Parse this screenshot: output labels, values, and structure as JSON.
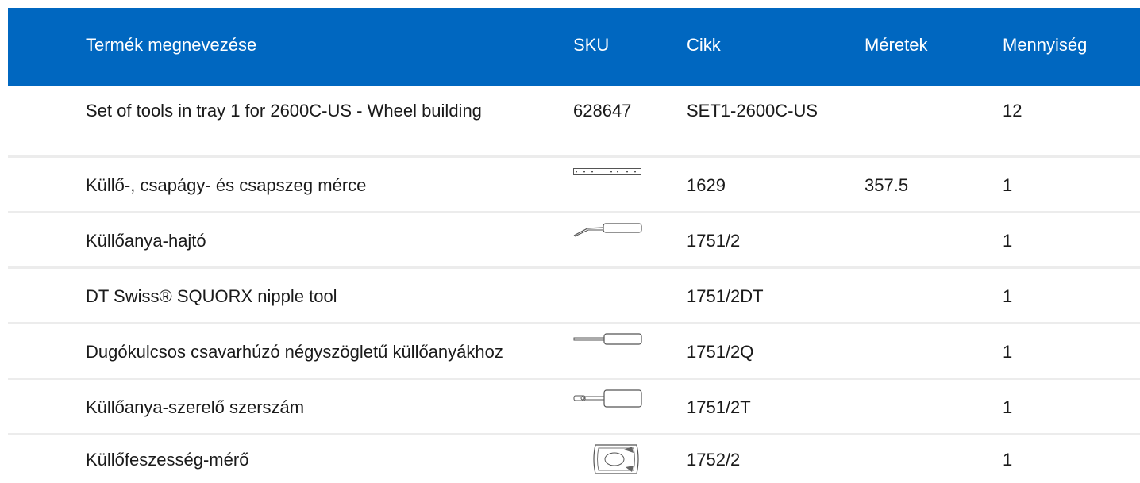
{
  "header": {
    "name": "Termék megnevezése",
    "sku": "SKU",
    "cikk": "Cikk",
    "size": "Méretek",
    "qty": "Mennyiség"
  },
  "rows": [
    {
      "name": "Set of tools in tray 1 for 2600C-US - Wheel building",
      "sku": "628647",
      "cikk": "SET1-2600C-US",
      "size": "",
      "qty": "12",
      "image": ""
    },
    {
      "name": "Küllő-, csapágy- és csapszeg mérce",
      "sku": "",
      "cikk": "1629",
      "size": "357.5",
      "qty": "1",
      "image": "ruler-icon"
    },
    {
      "name": "Küllőanya-hajtó",
      "sku": "",
      "cikk": "1751/2",
      "size": "",
      "qty": "1",
      "image": "nipple-driver-icon"
    },
    {
      "name": "DT Swiss® SQUORX nipple tool",
      "sku": "",
      "cikk": "1751/2DT",
      "size": "",
      "qty": "1",
      "image": ""
    },
    {
      "name": "Dugókulcsos csavarhúzó négyszögletű küllőanyákhoz",
      "sku": "",
      "cikk": "1751/2Q",
      "size": "",
      "qty": "1",
      "image": "socket-screwdriver-icon"
    },
    {
      "name": "Küllőanya-szerelő szerszám",
      "sku": "",
      "cikk": "1751/2T",
      "size": "",
      "qty": "1",
      "image": "nipple-tool-icon"
    },
    {
      "name": "Küllőfeszesség-mérő",
      "sku": "",
      "cikk": "1752/2",
      "size": "",
      "qty": "1",
      "image": "tension-meter-icon"
    }
  ]
}
